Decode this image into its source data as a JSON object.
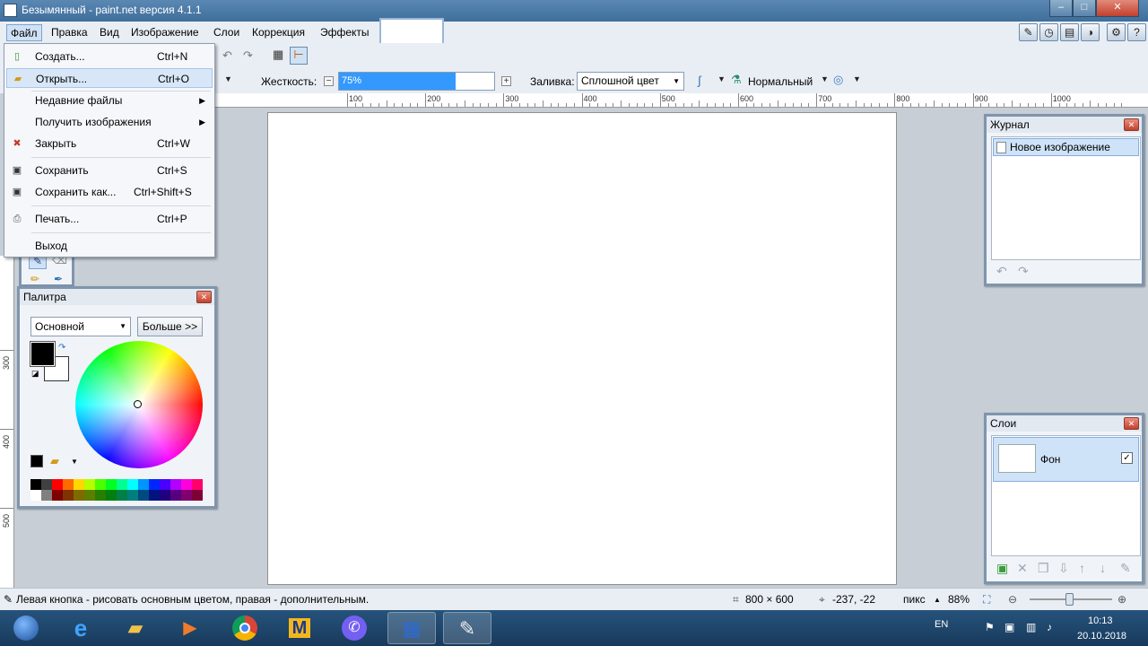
{
  "window": {
    "title": "Безымянный - paint.net версия 4.1.1",
    "controls": {
      "minimize": "–",
      "maximize": "□",
      "close": "✕"
    }
  },
  "menubar": {
    "items": [
      {
        "label": "Файл"
      },
      {
        "label": "Правка"
      },
      {
        "label": "Вид"
      },
      {
        "label": "Изображение"
      },
      {
        "label": "Слои"
      },
      {
        "label": "Коррекция"
      },
      {
        "label": "Эффекты"
      }
    ]
  },
  "file_menu": {
    "items": [
      {
        "label": "Создать...",
        "shortcut": "Ctrl+N",
        "icon": "new-file-icon"
      },
      {
        "label": "Открыть...",
        "shortcut": "Ctrl+O",
        "icon": "open-folder-icon",
        "highlighted": true
      },
      {
        "label": "Недавние файлы",
        "submenu": true
      },
      {
        "label": "Получить изображения",
        "submenu": true
      },
      {
        "label": "Закрыть",
        "shortcut": "Ctrl+W",
        "icon": "close-file-icon"
      },
      {
        "label": "Сохранить",
        "shortcut": "Ctrl+S",
        "icon": "save-icon"
      },
      {
        "label": "Сохранить как...",
        "shortcut": "Ctrl+Shift+S",
        "icon": "save-as-icon"
      },
      {
        "label": "Печать...",
        "shortcut": "Ctrl+P",
        "icon": "print-icon"
      },
      {
        "label": "Выход"
      }
    ]
  },
  "toolbar": {
    "hardness_label": "Жесткость:",
    "hardness_value": "75%",
    "hardness_percent": 75,
    "fill_label": "Заливка:",
    "fill_value": "Сплошной цвет",
    "blend_mode": "Нормальный"
  },
  "ruler": {
    "h_labels": [
      "100",
      "200",
      "300",
      "400",
      "500",
      "600",
      "700",
      "800",
      "900",
      "1000"
    ],
    "v_labels": [
      "300",
      "400",
      "500"
    ]
  },
  "history_panel": {
    "title": "Журнал",
    "items": [
      "Новое изображение"
    ]
  },
  "layers_panel": {
    "title": "Слои",
    "layers": [
      {
        "name": "Фон",
        "visible": "✓"
      }
    ]
  },
  "palette_panel": {
    "title": "Палитра",
    "palette_name": "Основной",
    "more_button": "Больше >>",
    "primary_color": "#000000",
    "secondary_color": "#ffffff"
  },
  "statusbar": {
    "hint": "Левая кнопка - рисовать основным цветом, правая - дополнительным.",
    "image_size": "800 × 600",
    "cursor_pos": "-237, -22",
    "units": "пикс",
    "zoom": "88%"
  },
  "taskbar": {
    "language": "EN",
    "time": "10:13",
    "date": "20.10.2018"
  }
}
